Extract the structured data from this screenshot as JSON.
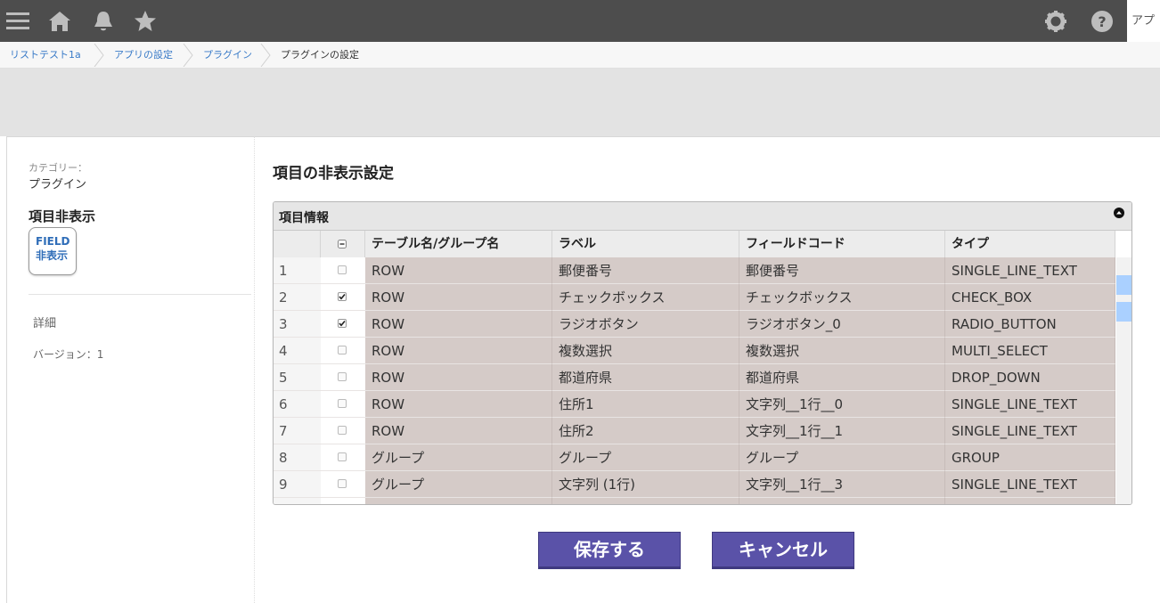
{
  "topbar": {
    "icons": [
      "menu-icon",
      "home-icon",
      "bell-icon",
      "star-icon",
      "gear-icon",
      "help-icon"
    ],
    "app_switch_label": "アプ"
  },
  "breadcrumb": [
    "リストテスト1a",
    "アプリの設定",
    "プラグイン",
    "プラグインの設定"
  ],
  "sidebar": {
    "category_label": "カテゴリー：",
    "category_value": "プラグイン",
    "plugin_name": "項目非表示",
    "plugin_icon_line1": "FIELD",
    "plugin_icon_line2": "非表示",
    "detail_link": "詳細",
    "version": "バージョン：1"
  },
  "main": {
    "title": "項目の非表示設定",
    "panel_title": "項目情報",
    "columns": [
      "テーブル名/グループ名",
      "ラベル",
      "フィールドコード",
      "タイプ"
    ],
    "rows": [
      {
        "no": "1",
        "checked": false,
        "group": "ROW",
        "label": "郵便番号",
        "code": "郵便番号",
        "type": "SINGLE_LINE_TEXT"
      },
      {
        "no": "2",
        "checked": true,
        "group": "ROW",
        "label": "チェックボックス",
        "code": "チェックボックス",
        "type": "CHECK_BOX"
      },
      {
        "no": "3",
        "checked": true,
        "group": "ROW",
        "label": "ラジオボタン",
        "code": "ラジオボタン_0",
        "type": "RADIO_BUTTON"
      },
      {
        "no": "4",
        "checked": false,
        "group": "ROW",
        "label": "複数選択",
        "code": "複数選択",
        "type": "MULTI_SELECT"
      },
      {
        "no": "5",
        "checked": false,
        "group": "ROW",
        "label": "都道府県",
        "code": "都道府県",
        "type": "DROP_DOWN"
      },
      {
        "no": "6",
        "checked": false,
        "group": "ROW",
        "label": "住所1",
        "code": "文字列__1行__0",
        "type": "SINGLE_LINE_TEXT"
      },
      {
        "no": "7",
        "checked": false,
        "group": "ROW",
        "label": "住所2",
        "code": "文字列__1行__1",
        "type": "SINGLE_LINE_TEXT"
      },
      {
        "no": "8",
        "checked": false,
        "group": "グループ",
        "label": "グループ",
        "code": "グループ",
        "type": "GROUP"
      },
      {
        "no": "9",
        "checked": false,
        "group": "グループ",
        "label": "文字列 (1行)",
        "code": "文字列__1行__3",
        "type": "SINGLE_LINE_TEXT"
      }
    ],
    "save_label": "保存する",
    "cancel_label": "キャンセル"
  },
  "colors": {
    "topbar": "#4d4d4d",
    "row_bg": "#d5cbc8",
    "button": "#5a52a8",
    "link": "#3a7bc8",
    "scroll_marker": "#aad0ff"
  }
}
